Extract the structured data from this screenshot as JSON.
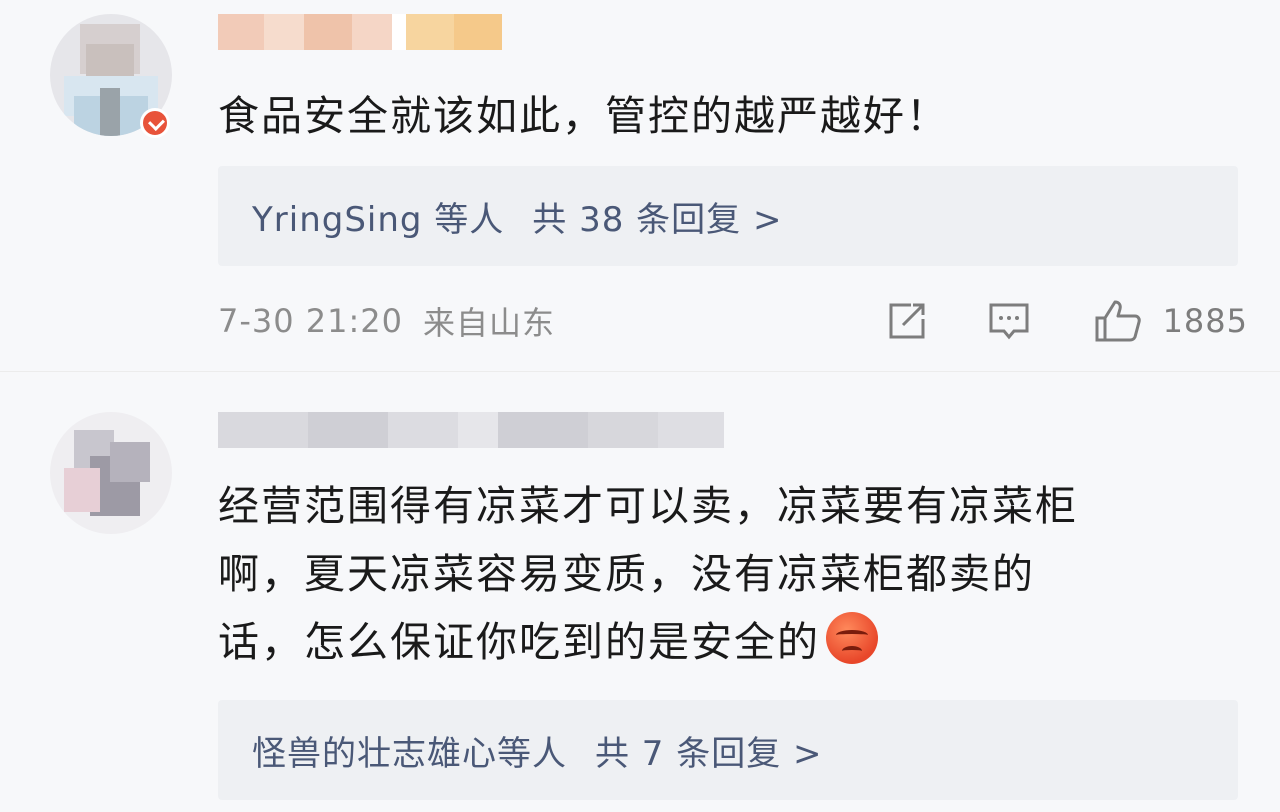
{
  "comments": [
    {
      "text": "食品安全就该如此，管控的越严越好！",
      "replies_summary": {
        "users": "YringSing 等人",
        "count_text": "共 38 条回复 >"
      },
      "meta": {
        "datetime": "7-30  21:20",
        "location": "来自山东",
        "like_count": "1885"
      }
    },
    {
      "text_lines": [
        "经营范围得有凉菜才可以卖，凉菜要有凉菜柜",
        "啊，夏天凉菜容易变质，没有凉菜柜都卖的",
        "话，怎么保证你吃到的是安全的"
      ],
      "emoji": "angry-face-emoji",
      "replies_summary": {
        "users": "怪兽的壮志雄心等人",
        "count_text": "共 7 条回复 >"
      }
    }
  ],
  "icons": {
    "share": "share-icon",
    "comment": "comment-icon",
    "like": "thumbs-up-icon",
    "verified": "verified-badge-icon"
  },
  "colors": {
    "reply_text": "#4a5877",
    "reply_bg": "#eef0f3",
    "meta_text": "#8c8c8c",
    "verified_badge": "#e8533a"
  }
}
